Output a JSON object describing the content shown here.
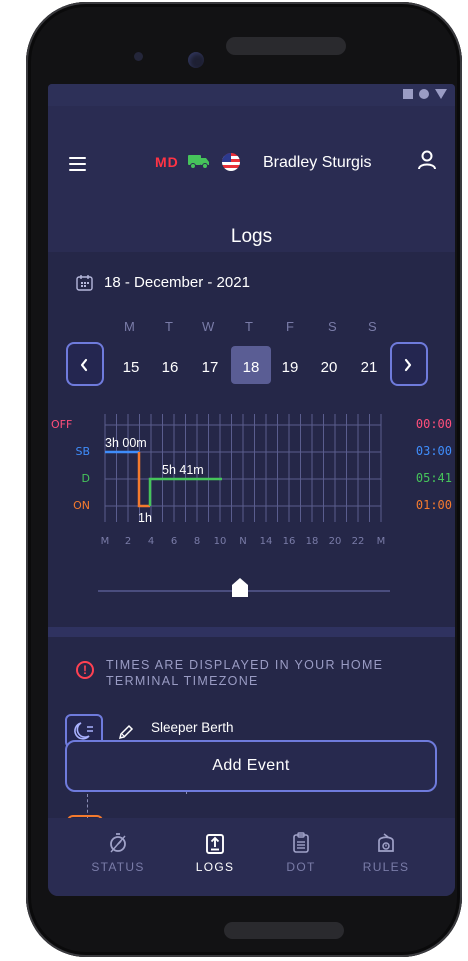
{
  "header": {
    "region_badge": "MD",
    "driver_name": "Bradley Sturgis",
    "title": "Logs"
  },
  "date_selector": {
    "date_label": "18 - December - 2021",
    "weekdays": [
      "M",
      "T",
      "W",
      "T",
      "F",
      "S",
      "S"
    ],
    "days": [
      "15",
      "16",
      "17",
      "18",
      "19",
      "20",
      "21"
    ],
    "selected_day": "18"
  },
  "log_graph": {
    "status_labels": [
      "OFF",
      "SB",
      "D",
      "ON"
    ],
    "durations": [
      "00:00",
      "03:00",
      "05:41",
      "01:00"
    ],
    "time_ticks": [
      "M",
      "2",
      "4",
      "6",
      "8",
      "10",
      "N",
      "14",
      "16",
      "18",
      "20",
      "22",
      "M"
    ],
    "annotations": [
      "3h 00m",
      "5h 41m",
      "1h"
    ],
    "status_colors": {
      "OFF": "#ff4f7b",
      "SB": "#3f8dfb",
      "D": "#46c45b",
      "ON": "#f47a2e"
    },
    "slider_value": 0.5
  },
  "notice": {
    "text": "TIMES ARE DISPLAYED IN YOUR HOME TERMINAL TIMEZONE"
  },
  "events": [
    {
      "label": "Sleeper Berth",
      "icon": "sleeper-icon"
    }
  ],
  "add_event_label": "Add Event",
  "bottom_nav": [
    {
      "label": "STATUS",
      "icon": "stopwatch-icon",
      "active": false
    },
    {
      "label": "LOGS",
      "icon": "logs-icon",
      "active": true
    },
    {
      "label": "DOT",
      "icon": "clipboard-icon",
      "active": false
    },
    {
      "label": "RULES",
      "icon": "rules-icon",
      "active": false
    }
  ]
}
